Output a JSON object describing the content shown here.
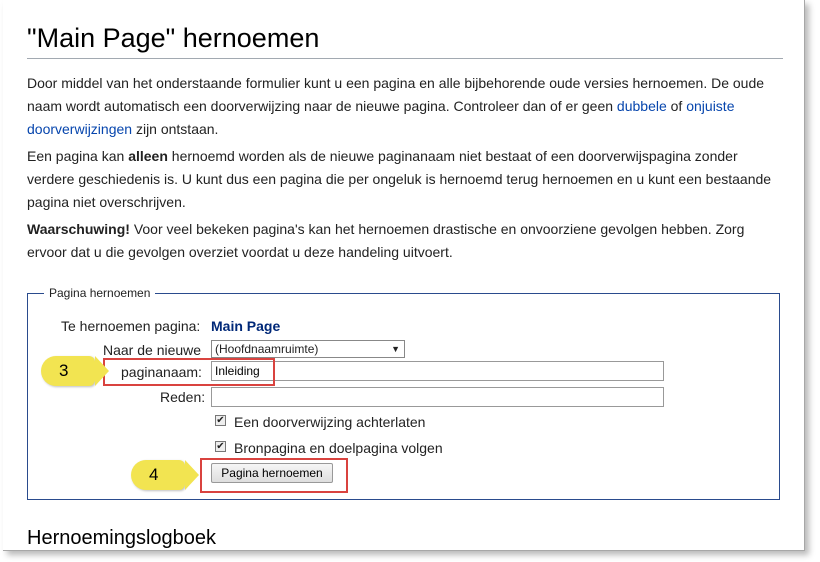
{
  "page": {
    "title": "\"Main Page\" hernoemen",
    "intro": {
      "text_before": "Door middel van het onderstaande formulier kunt u een pagina en alle bijbehorende oude versies hernoemen. De oude naam wordt automatisch een doorverwijzing naar de nieuwe pagina. Controleer dan of er geen ",
      "link1": "dubbele",
      "text_middle": " of ",
      "link2": "onjuiste doorverwijzingen",
      "text_after": " zijn ontstaan."
    },
    "note": {
      "text_before": "Een pagina kan ",
      "bold": "alleen",
      "text_after": " hernoemd worden als de nieuwe paginanaam niet bestaat of een doorverwijspagina zonder verdere geschiedenis is. U kunt dus een pagina die per ongeluk is hernoemd terug hernoemen en u kunt een bestaande pagina niet overschrijven."
    },
    "warning": {
      "bold": "Waarschuwing!",
      "text": " Voor veel bekeken pagina's kan het hernoemen drastische en onvoorziene gevolgen hebben. Zorg ervoor dat u die gevolgen overziet voordat u deze handeling uitvoert."
    }
  },
  "form": {
    "legend": "Pagina hernoemen",
    "current_label": "Te hernoemen pagina:",
    "current_value": "Main Page",
    "new_label_line1": "Naar de nieuwe",
    "new_label_line2": "paginanaam:",
    "namespace_selected": "(Hoofdnaamruimte)",
    "new_title_value": "Inleiding",
    "reason_label": "Reden:",
    "reason_value": "",
    "checkbox_redirect_label": "Een doorverwijzing achterlaten",
    "checkbox_redirect_checked": true,
    "checkbox_watch_label": "Bronpagina en doelpagina volgen",
    "checkbox_watch_checked": true,
    "submit_label": "Pagina hernoemen"
  },
  "annotations": {
    "step3": "3",
    "step4": "4",
    "highlight_color": "#d9433f",
    "badge_color": "#f2e451"
  },
  "log_section": {
    "heading": "Hernoemingslogboek"
  },
  "colors": {
    "link": "#0645ad",
    "page_name": "#002878",
    "fieldset_border": "#2a4b8d"
  }
}
